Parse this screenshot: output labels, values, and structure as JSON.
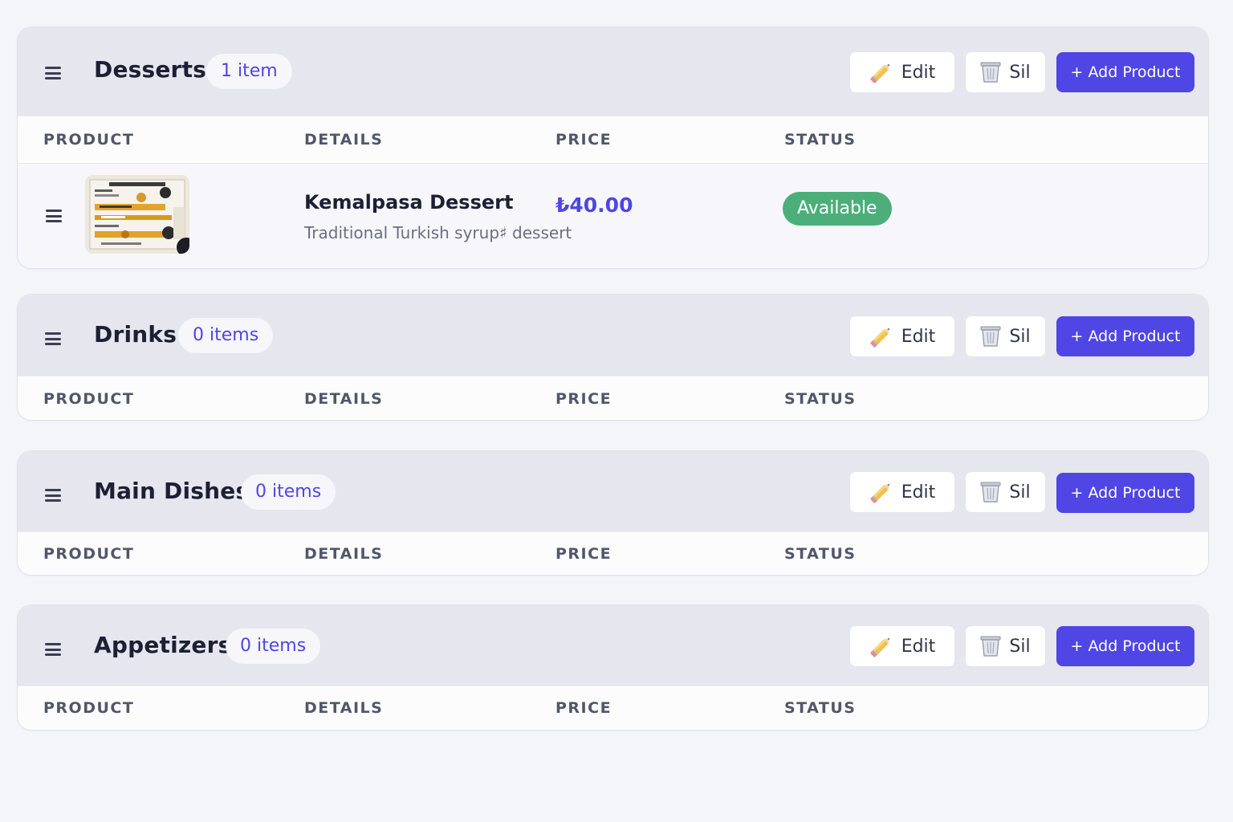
{
  "categories": [
    {
      "name": "Desserts",
      "count_label": "1 item",
      "edit_label": "Edit",
      "delete_label": "Sil",
      "add_label": "+ Add Product",
      "columns": [
        "PRODUCT",
        "DETAILS",
        "PRICE",
        "STATUS"
      ],
      "products": [
        {
          "name": "Kemalpasa Dessert",
          "description": "Traditional Turkish syrup♯ dessert",
          "price": "₺40.00",
          "status": "Available"
        }
      ]
    },
    {
      "name": "Drinks",
      "count_label": "0 items",
      "edit_label": "Edit",
      "delete_label": "Sil",
      "add_label": "+ Add Product",
      "columns": [
        "PRODUCT",
        "DETAILS",
        "PRICE",
        "STATUS"
      ],
      "products": []
    },
    {
      "name": "Main Dishes",
      "count_label": "0 items",
      "edit_label": "Edit",
      "delete_label": "Sil",
      "add_label": "+ Add Product",
      "columns": [
        "PRODUCT",
        "DETAILS",
        "PRICE",
        "STATUS"
      ],
      "products": []
    },
    {
      "name": "Appetizers",
      "count_label": "0 items",
      "edit_label": "Edit",
      "delete_label": "Sil",
      "add_label": "+ Add Product",
      "columns": [
        "PRODUCT",
        "DETAILS",
        "PRICE",
        "STATUS"
      ],
      "products": []
    }
  ],
  "icons": {
    "drag": "drag-handle-icon",
    "edit": "pencil-icon",
    "delete": "trash-icon",
    "thumbnail": "product-thumbnail"
  },
  "colors": {
    "accent": "#4f46e5",
    "status_available": "#4caf7a",
    "category_header": "#e5e6ee"
  }
}
